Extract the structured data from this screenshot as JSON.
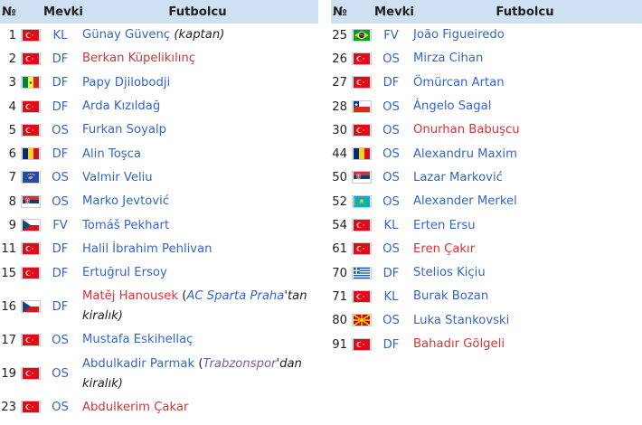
{
  "headers": {
    "num": "№",
    "pos": "Mevki",
    "player": "Futbolcu"
  },
  "left": [
    {
      "num": "1",
      "flag": "turkey-flag-icon",
      "pos": "KL",
      "name": "Günay Güvenç",
      "name_color": "blue",
      "note": "(kaptan)"
    },
    {
      "num": "2",
      "flag": "turkey-flag-icon",
      "pos": "DF",
      "name": "Berkan Küpelikılınç",
      "name_color": "red"
    },
    {
      "num": "3",
      "flag": "senegal-flag-icon",
      "pos": "DF",
      "name": "Papy Djilobodji",
      "name_color": "blue"
    },
    {
      "num": "4",
      "flag": "turkey-flag-icon",
      "pos": "DF",
      "name": "Arda Kızıldağ",
      "name_color": "blue"
    },
    {
      "num": "5",
      "flag": "turkey-flag-icon",
      "pos": "OS",
      "name": "Furkan Soyalp",
      "name_color": "blue"
    },
    {
      "num": "6",
      "flag": "romania-flag-icon",
      "pos": "DF",
      "name": "Alin Toşca",
      "name_color": "blue"
    },
    {
      "num": "7",
      "flag": "kosovo-flag-icon",
      "pos": "OS",
      "name": "Valmir Veliu",
      "name_color": "blue"
    },
    {
      "num": "8",
      "flag": "serbia-flag-icon",
      "pos": "OS",
      "name": "Marko Jevtović",
      "name_color": "blue"
    },
    {
      "num": "9",
      "flag": "czech-flag-icon",
      "pos": "FV",
      "name": "Tomáš Pekhart",
      "name_color": "blue"
    },
    {
      "num": "11",
      "flag": "turkey-flag-icon",
      "pos": "DF",
      "name": "Halil İbrahim Pehlivan",
      "name_color": "blue"
    },
    {
      "num": "15",
      "flag": "turkey-flag-icon",
      "pos": "DF",
      "name": "Ertuğrul Ersoy",
      "name_color": "blue"
    },
    {
      "num": "16",
      "flag": "czech-flag-icon",
      "pos": "DF",
      "name": "Matěj Hanousek",
      "name_color": "red",
      "loan_open": " (",
      "loan_club": "AC Sparta Praha",
      "loan_club_color": "blue",
      "loan_suffix": "'tan kiralık)"
    },
    {
      "num": "17",
      "flag": "turkey-flag-icon",
      "pos": "OS",
      "name": "Mustafa Eskihellaç",
      "name_color": "blue"
    },
    {
      "num": "19",
      "flag": "turkey-flag-icon",
      "pos": "OS",
      "name": "Abdulkadir Parmak",
      "name_color": "blue",
      "loan_open": " (",
      "loan_club": "Trabzonspor",
      "loan_club_color": "purple",
      "loan_suffix": "'dan kiralık)"
    },
    {
      "num": "23",
      "flag": "turkey-flag-icon",
      "pos": "OS",
      "name": "Abdulkerim Çakar",
      "name_color": "red"
    }
  ],
  "right": [
    {
      "num": "25",
      "flag": "brazil-flag-icon",
      "pos": "FV",
      "name": "João Figueiredo",
      "name_color": "blue"
    },
    {
      "num": "26",
      "flag": "turkey-flag-icon",
      "pos": "OS",
      "name": "Mirza Cihan",
      "name_color": "blue"
    },
    {
      "num": "27",
      "flag": "turkey-flag-icon",
      "pos": "DF",
      "name": "Ömürcan Artan",
      "name_color": "blue"
    },
    {
      "num": "28",
      "flag": "chile-flag-icon",
      "pos": "OS",
      "name": "Ángelo Sagal",
      "name_color": "blue"
    },
    {
      "num": "30",
      "flag": "turkey-flag-icon",
      "pos": "OS",
      "name": "Onurhan Babuşcu",
      "name_color": "red"
    },
    {
      "num": "44",
      "flag": "romania-flag-icon",
      "pos": "OS",
      "name": "Alexandru Maxim",
      "name_color": "blue"
    },
    {
      "num": "50",
      "flag": "serbia-flag-icon",
      "pos": "OS",
      "name": "Lazar Marković",
      "name_color": "blue"
    },
    {
      "num": "52",
      "flag": "kazakhstan-flag-icon",
      "pos": "OS",
      "name": "Alexander Merkel",
      "name_color": "blue"
    },
    {
      "num": "54",
      "flag": "turkey-flag-icon",
      "pos": "KL",
      "name": "Erten Ersu",
      "name_color": "blue"
    },
    {
      "num": "61",
      "flag": "turkey-flag-icon",
      "pos": "OS",
      "name": "Eren Çakır",
      "name_color": "red"
    },
    {
      "num": "70",
      "flag": "greece-flag-icon",
      "pos": "DF",
      "name": "Stelios Kiçiu",
      "name_color": "blue"
    },
    {
      "num": "71",
      "flag": "turkey-flag-icon",
      "pos": "KL",
      "name": "Burak Bozan",
      "name_color": "blue"
    },
    {
      "num": "80",
      "flag": "macedonia-flag-icon",
      "pos": "OS",
      "name": "Luka Stankovski",
      "name_color": "blue"
    },
    {
      "num": "91",
      "flag": "turkey-flag-icon",
      "pos": "DF",
      "name": "Bahadır Gölgeli",
      "name_color": "red"
    }
  ],
  "colors": {
    "header_bg": "#cfe0f3",
    "link": "#3366cc",
    "redlink": "#d73333",
    "visited": "#795cb2"
  }
}
